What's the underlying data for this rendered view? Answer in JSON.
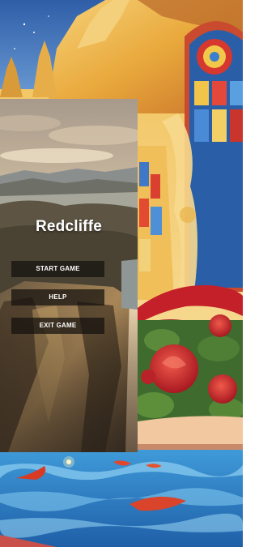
{
  "game": {
    "title": "Redcliffe"
  },
  "menu": {
    "start_label": "START GAME",
    "help_label": "HELP",
    "exit_label": "EXIT GAME"
  },
  "colors": {
    "button_bg": "#14100e",
    "button_text": "#ffffff",
    "title_text": "#ffffff",
    "sky_blue": "#3e74b8",
    "gold": "#e9b348",
    "rose_red": "#c8242b",
    "pool_blue": "#2e7fc4"
  }
}
